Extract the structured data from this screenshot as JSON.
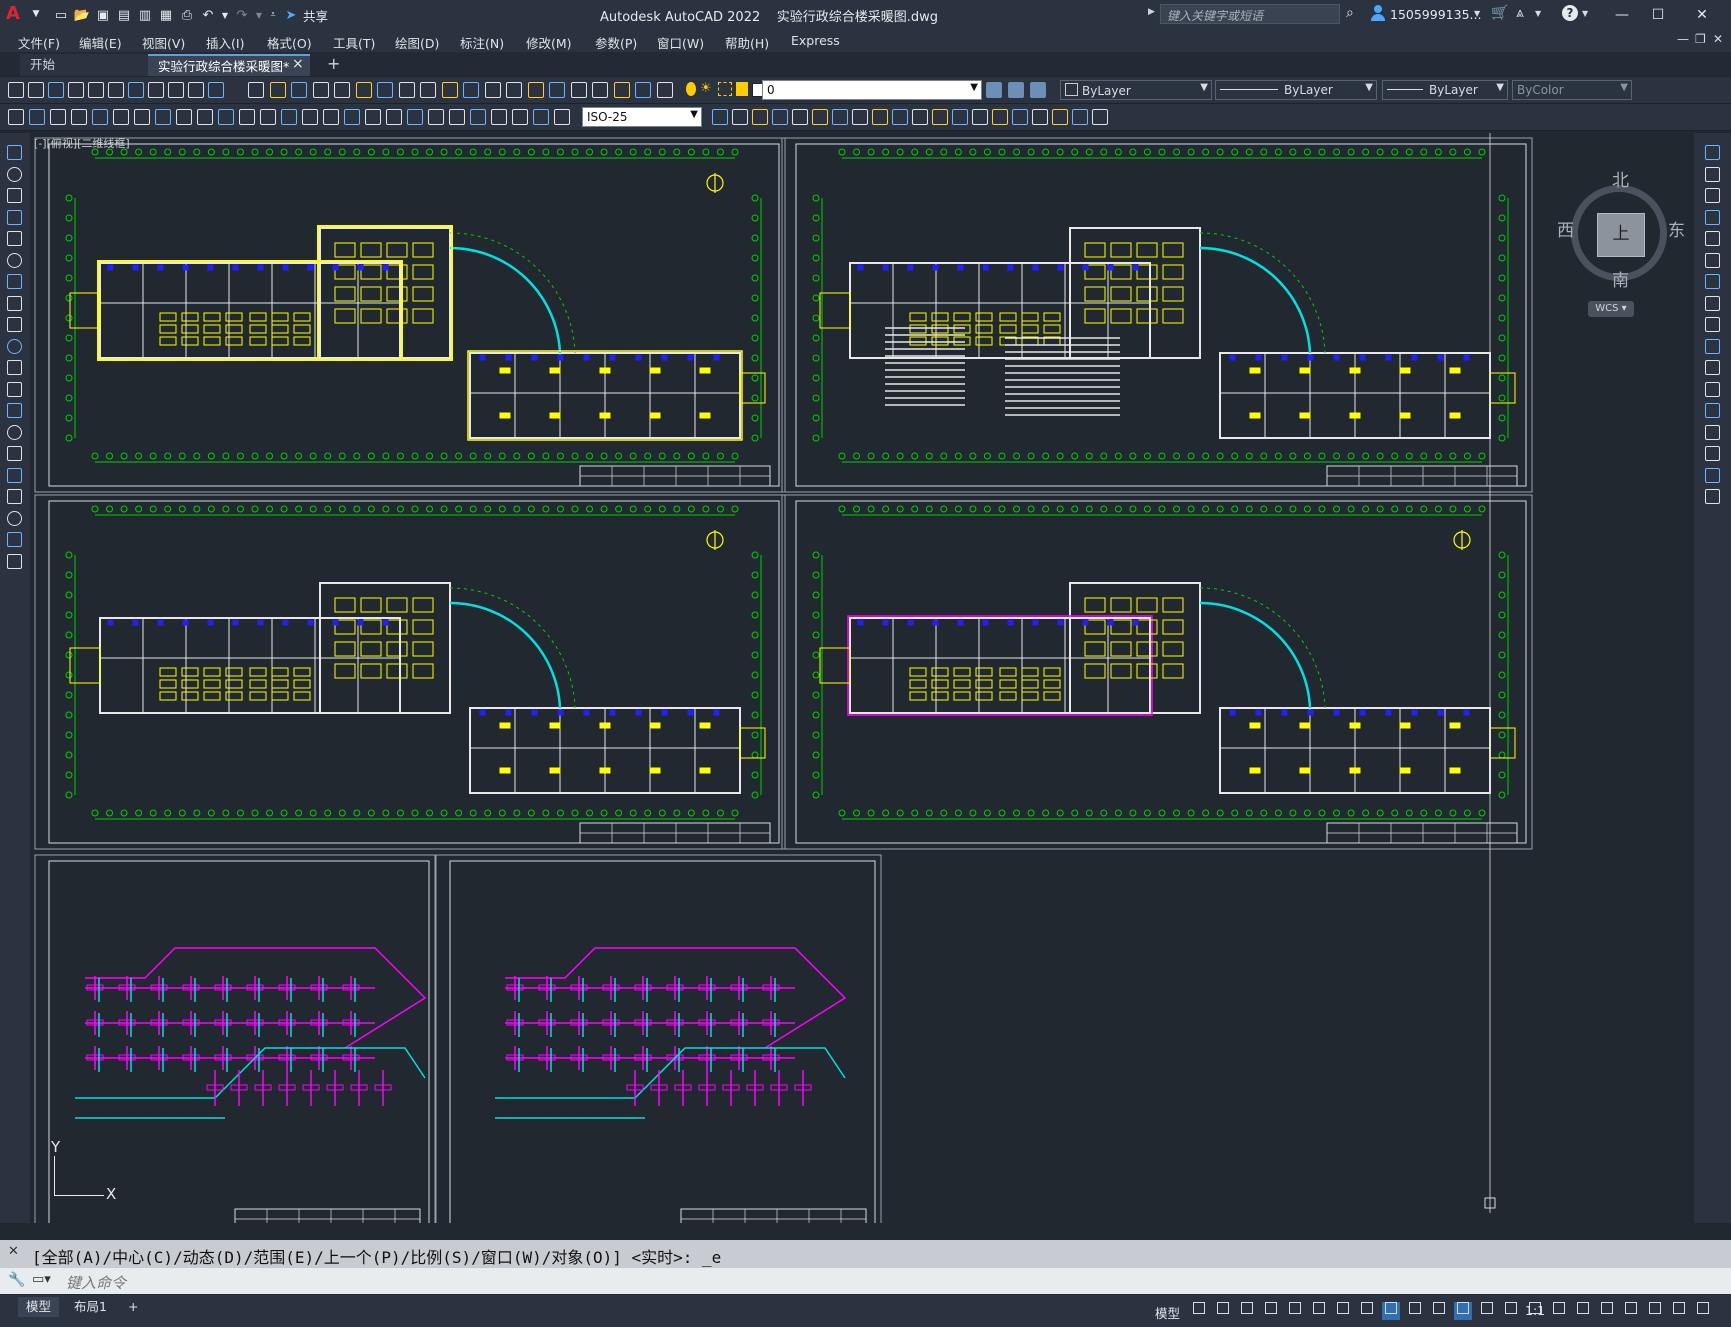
{
  "app": {
    "title": "Autodesk AutoCAD 2022",
    "filename": "实验行政综合楼采暖图.dwg",
    "share_label": "共享",
    "search_placeholder": "键入关键字或短语",
    "user": "1505999135...",
    "logo": "A"
  },
  "menu": [
    "文件(F)",
    "编辑(E)",
    "视图(V)",
    "插入(I)",
    "格式(O)",
    "工具(T)",
    "绘图(D)",
    "标注(N)",
    "修改(M)",
    "参数(P)",
    "窗口(W)",
    "帮助(H)",
    "Express"
  ],
  "tabs": {
    "start": "开始",
    "active": "实验行政综合楼采暖图*",
    "close": "×",
    "add": "+"
  },
  "properties": {
    "layer": "0",
    "color": "ByLayer",
    "linetype": "ByLayer",
    "lineweight": "ByLayer",
    "plotstyle": "ByColor",
    "dimstyle": "ISO-25"
  },
  "viewport_label": "[-][俯视][二维线框]",
  "viewcube": {
    "north": "北",
    "south": "南",
    "east": "东",
    "west": "西",
    "face": "上",
    "wcs": "WCS"
  },
  "ucs": {
    "x": "X",
    "y": "Y"
  },
  "command": {
    "history": "[全部(A)/中心(C)/动态(D)/范围(E)/上一个(P)/比例(S)/窗口(W)/对象(O)] <实时>: _e",
    "placeholder": "键入命令"
  },
  "status": {
    "model_tab": "模型",
    "layout_tab": "布局1",
    "add": "+",
    "model_btn": "模型",
    "scale": "1:1"
  },
  "colors": {
    "background": "#212830",
    "walls": "#ffffff",
    "axis_green": "#00d000",
    "furniture_yellow": "#ffff00",
    "pipe_cyan": "#00e0e0",
    "pipe_magenta": "#ff00ff",
    "pipe_blue": "#2020ff"
  }
}
